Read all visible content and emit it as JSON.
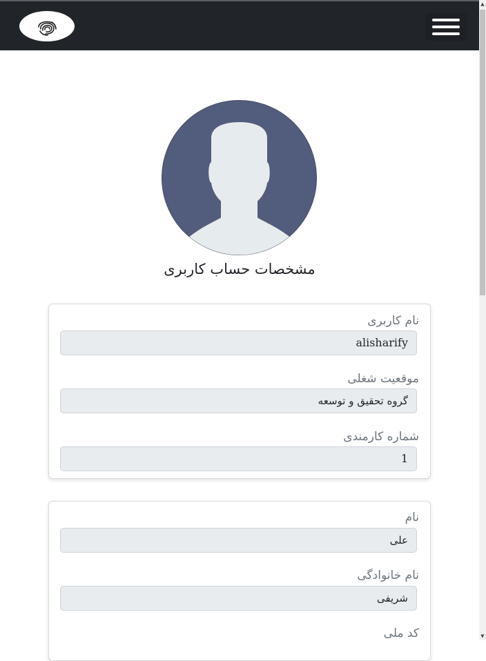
{
  "header": {
    "logo_icon": "fingerprint-logo-icon",
    "menu_icon": "hamburger-menu-icon"
  },
  "profile": {
    "avatar_icon": "user-avatar-icon",
    "title": "مشخصات حساب کاربری"
  },
  "account_card": {
    "username_label": "نام کاربری",
    "username_value": "alisharify",
    "job_label": "موقعیت شغلی",
    "job_value": "گروه تحقیق و توسعه",
    "employee_no_label": "شماره کارمندی",
    "employee_no_value": "1"
  },
  "personal_card": {
    "first_name_label": "نام",
    "first_name_value": "علی",
    "last_name_label": "نام خانوادگی",
    "last_name_value": "شریفی",
    "national_id_label": "کد ملی"
  },
  "colors": {
    "navbar": "#212529",
    "avatar_bg": "#525c7c",
    "avatar_figure": "#e6ebed",
    "input_bg": "#e9ecef"
  }
}
